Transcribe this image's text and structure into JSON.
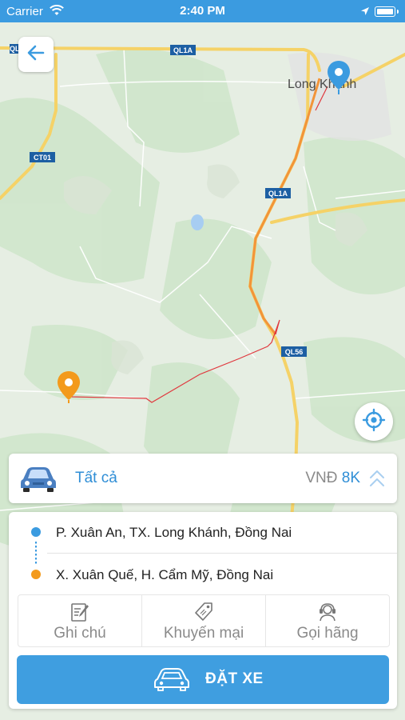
{
  "status_bar": {
    "carrier": "Carrier",
    "time": "2:40 PM",
    "icons": [
      "wifi-icon",
      "location-arrow-icon",
      "battery-icon"
    ]
  },
  "map": {
    "place_label": "Long Khánh",
    "road_labels": [
      "QL1A",
      "QL1A",
      "CT01",
      "QL1A",
      "QL56"
    ],
    "pickup_pin_color": "#3b9be0",
    "dropoff_pin_color": "#f39a1c",
    "route_color": "#e0383e"
  },
  "buttons": {
    "back_icon": "arrow-left-icon",
    "locate_icon": "crosshair-icon"
  },
  "service": {
    "icon": "car-icon",
    "name": "Tất cả",
    "currency": "VNĐ",
    "amount": "8K",
    "expand_icon": "chevron-double-up-icon"
  },
  "trip": {
    "pickup": "P. Xuân An, TX. Long Khánh, Đồng Nai",
    "dropoff": "X. Xuân Quế, H. Cẩm Mỹ, Đồng Nai"
  },
  "actions": [
    {
      "label": "Ghi chú",
      "icon": "note-icon"
    },
    {
      "label": "Khuyến mại",
      "icon": "tag-icon"
    },
    {
      "label": "Gọi hãng",
      "icon": "headset-icon"
    }
  ],
  "book_button": {
    "label": "ĐẶT XE",
    "icon": "car-outline-icon"
  },
  "colors": {
    "accent": "#3b9be0",
    "orange": "#f39a1c"
  }
}
